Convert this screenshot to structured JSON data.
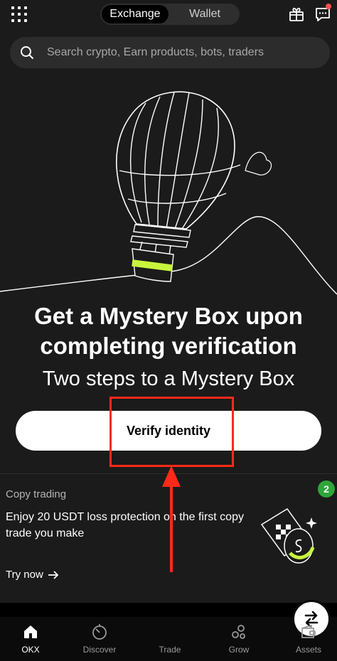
{
  "topbar": {
    "tabs": [
      {
        "label": "Exchange",
        "active": true
      },
      {
        "label": "Wallet",
        "active": false
      }
    ],
    "icons": [
      "apps-grid-icon",
      "gift-icon",
      "chat-icon"
    ]
  },
  "search": {
    "placeholder": "Search crypto, Earn products, bots, traders"
  },
  "hero": {
    "title": "Get a Mystery Box upon completing verification",
    "subtitle": "Two steps to a Mystery Box",
    "button_label": "Verify identity",
    "accent_color": "#c8f53c"
  },
  "copy_trading": {
    "label": "Copy trading",
    "text": "Enjoy 20 USDT loss protection on the first copy trade you make",
    "cta": "Try now",
    "badge": "2"
  },
  "nav": {
    "items": [
      {
        "label": "OKX",
        "icon": "home-icon",
        "active": true
      },
      {
        "label": "Discover",
        "icon": "discover-icon",
        "active": false
      },
      {
        "label": "Trade",
        "icon": "swap-icon",
        "active": false
      },
      {
        "label": "Grow",
        "icon": "grow-icon",
        "active": false
      },
      {
        "label": "Assets",
        "icon": "wallet-icon",
        "active": false
      }
    ]
  },
  "annotation_color": "#ff2a1a"
}
